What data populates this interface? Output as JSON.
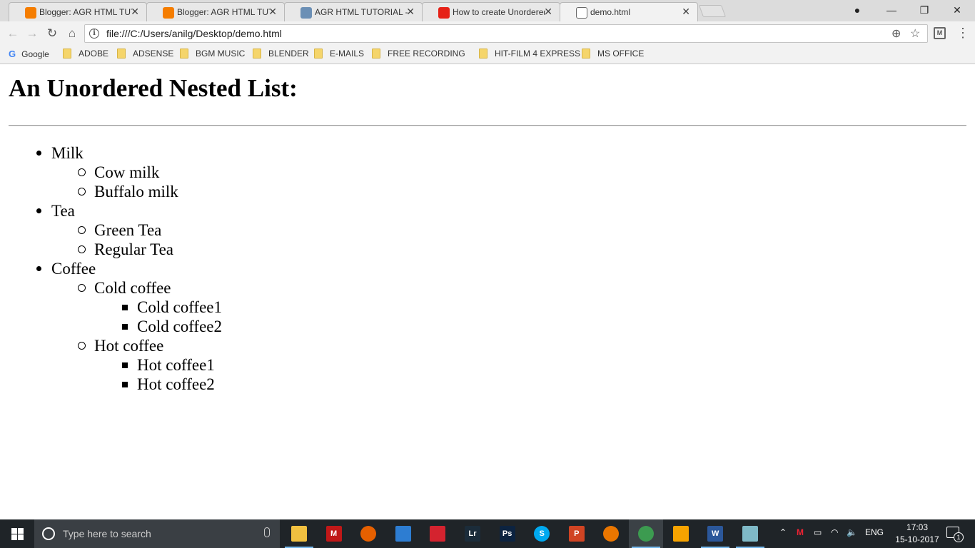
{
  "tabs": [
    {
      "label": "Blogger: AGR HTML TUTO",
      "icon": "blogger-icon",
      "color": "#f57d00"
    },
    {
      "label": "Blogger: AGR HTML TUTO",
      "icon": "blogger-icon",
      "color": "#f57d00"
    },
    {
      "label": "AGR HTML TUTORIAL - B",
      "icon": "globe-icon",
      "color": "#6b8fb5"
    },
    {
      "label": "How to create Unordered",
      "icon": "youtube-icon",
      "color": "#e62117"
    },
    {
      "label": "demo.html",
      "icon": "file-icon",
      "color": "#ffffff",
      "active": true
    }
  ],
  "toolbar": {
    "url": "file:///C:/Users/anilg/Desktop/demo.html",
    "extension_label": "M"
  },
  "bookmarks": [
    "Google",
    "ADOBE",
    "ADSENSE",
    "BGM MUSIC",
    "BLENDER",
    "E-MAILS",
    "FREE RECORDING SO",
    "HIT-FILM 4 EXPRESS",
    "MS OFFICE"
  ],
  "page": {
    "heading": "An Unordered Nested List:",
    "items": [
      {
        "label": "Milk",
        "level": 1
      },
      {
        "label": "Cow milk",
        "level": 2
      },
      {
        "label": "Buffalo milk",
        "level": 2
      },
      {
        "label": "Tea",
        "level": 1
      },
      {
        "label": "Green Tea",
        "level": 2
      },
      {
        "label": "Regular Tea",
        "level": 2
      },
      {
        "label": "Coffee",
        "level": 1
      },
      {
        "label": "Cold coffee",
        "level": 2
      },
      {
        "label": "Cold coffee1",
        "level": 3
      },
      {
        "label": "Cold coffee2",
        "level": 3
      },
      {
        "label": "Hot coffee",
        "level": 2
      },
      {
        "label": "Hot coffee1",
        "level": 3
      },
      {
        "label": "Hot coffee2",
        "level": 3
      }
    ]
  },
  "taskbar": {
    "search_placeholder": "Type here to search",
    "apps": [
      {
        "name": "file-explorer-icon",
        "label": "",
        "color": "#f0c040",
        "running": true
      },
      {
        "name": "mcafee-icon",
        "label": "M",
        "color": "#c01818"
      },
      {
        "name": "firefox-icon",
        "label": "",
        "color": "#e66000"
      },
      {
        "name": "news-icon",
        "label": "",
        "color": "#2d7dd2"
      },
      {
        "name": "creative-cloud-icon",
        "label": "",
        "color": "#d4232f"
      },
      {
        "name": "lightroom-icon",
        "label": "Lr",
        "color": "#1b2c3a"
      },
      {
        "name": "photoshop-icon",
        "label": "Ps",
        "color": "#0c2340"
      },
      {
        "name": "skype-icon",
        "label": "S",
        "color": "#00a9f0"
      },
      {
        "name": "powerpoint-icon",
        "label": "P",
        "color": "#d04423"
      },
      {
        "name": "blender-icon",
        "label": "",
        "color": "#ea7600"
      },
      {
        "name": "chrome-icon",
        "label": "",
        "color": "#3c9b50",
        "running": true,
        "active": true
      },
      {
        "name": "vlc-icon",
        "label": "",
        "color": "#f7a300"
      },
      {
        "name": "word-icon",
        "label": "W",
        "color": "#2b579a",
        "running": true
      },
      {
        "name": "notes-icon",
        "label": "",
        "color": "#7fb9c7",
        "running": true
      }
    ],
    "tray_lang": "ENG",
    "time": "17:03",
    "date": "15-10-2017",
    "notification_count": "1"
  }
}
